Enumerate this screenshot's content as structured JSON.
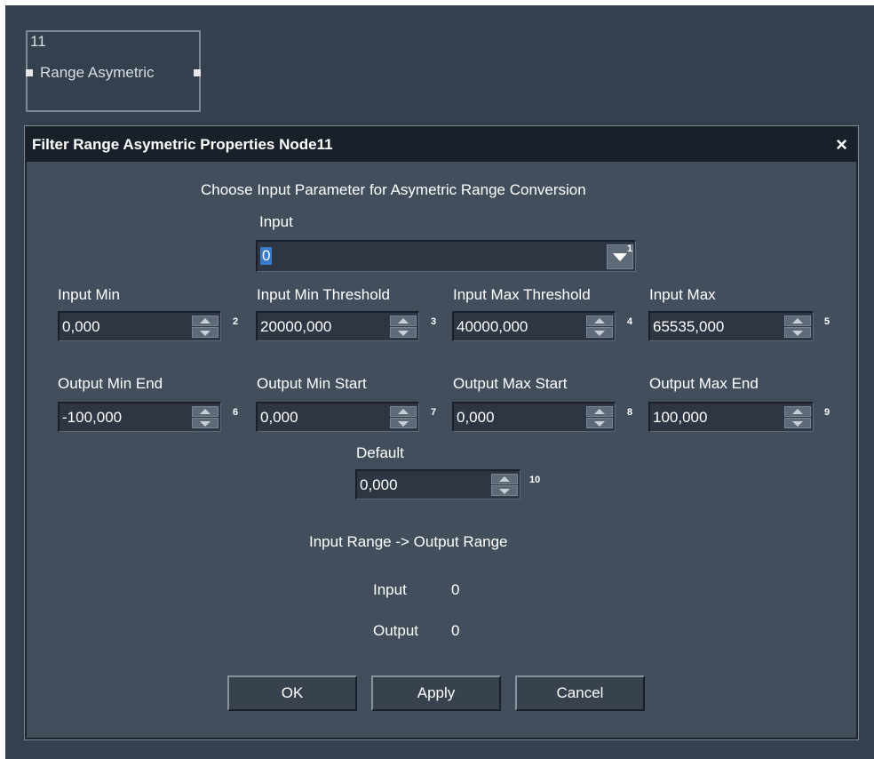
{
  "node": {
    "number": "11",
    "title": "Range Asymetric"
  },
  "dialog": {
    "title": "Filter Range Asymetric Properties Node11",
    "close": "×",
    "heading": "Choose Input Parameter for Asymetric Range Conversion",
    "input": {
      "label": "Input",
      "value": "0",
      "index": "1"
    },
    "row1": [
      {
        "label": "Input Min",
        "value": "0,000",
        "index": "2"
      },
      {
        "label": "Input Min Threshold",
        "value": "20000,000",
        "index": "3"
      },
      {
        "label": "Input Max Threshold",
        "value": "40000,000",
        "index": "4"
      },
      {
        "label": "Input Max",
        "value": "65535,000",
        "index": "5"
      }
    ],
    "row2": [
      {
        "label": "Output Min End",
        "value": "-100,000",
        "index": "6"
      },
      {
        "label": "Output Min Start",
        "value": "0,000",
        "index": "7"
      },
      {
        "label": "Output Max Start",
        "value": "0,000",
        "index": "8"
      },
      {
        "label": "Output Max End",
        "value": "100,000",
        "index": "9"
      }
    ],
    "default": {
      "label": "Default",
      "value": "0,000",
      "index": "10"
    },
    "range_heading": "Input Range -> Output Range",
    "readout": {
      "input_label": "Input",
      "input_value": "0",
      "output_label": "Output",
      "output_value": "0"
    },
    "buttons": {
      "ok": "OK",
      "apply": "Apply",
      "cancel": "Cancel"
    }
  }
}
